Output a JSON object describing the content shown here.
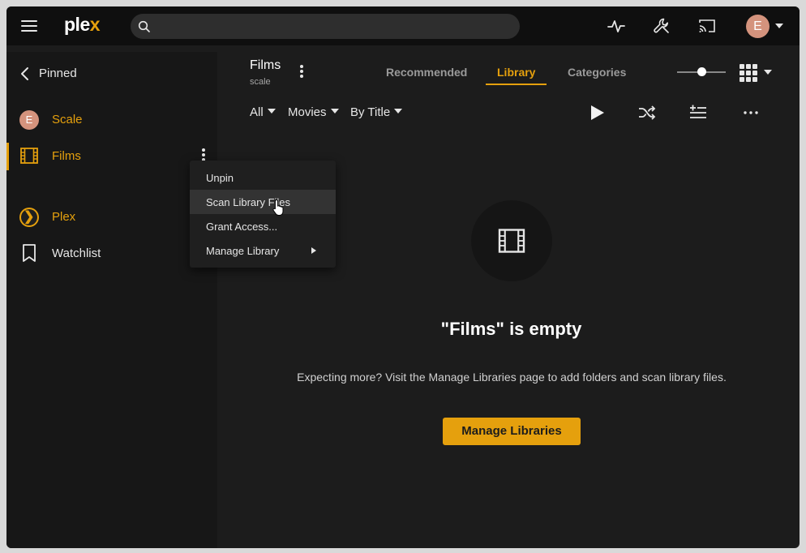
{
  "app": {
    "logo_main": "ple",
    "logo_x": "x"
  },
  "topbar": {
    "search_placeholder": "",
    "user_initial": "E"
  },
  "sidebar": {
    "pinned_label": "Pinned",
    "items": [
      {
        "label": "Scale",
        "initial": "E"
      },
      {
        "label": "Films"
      },
      {
        "label": "Plex"
      },
      {
        "label": "Watchlist"
      }
    ]
  },
  "context_menu": {
    "items": [
      {
        "label": "Unpin"
      },
      {
        "label": "Scan Library Files"
      },
      {
        "label": "Grant Access..."
      },
      {
        "label": "Manage Library"
      }
    ]
  },
  "library": {
    "title": "Films",
    "subtitle": "scale"
  },
  "tabs": [
    {
      "label": "Recommended"
    },
    {
      "label": "Library",
      "active": true
    },
    {
      "label": "Categories"
    }
  ],
  "filters": {
    "all": "All",
    "type": "Movies",
    "sort": "By Title"
  },
  "empty_state": {
    "title": "\"Films\" is empty",
    "description": "Expecting more? Visit the Manage Libraries page to add folders and scan library files.",
    "button": "Manage Libraries"
  },
  "colors": {
    "accent": "#e5a00d",
    "background": "#1c1c1c",
    "topbar": "#0f0f0f",
    "sidebar": "#171717"
  }
}
